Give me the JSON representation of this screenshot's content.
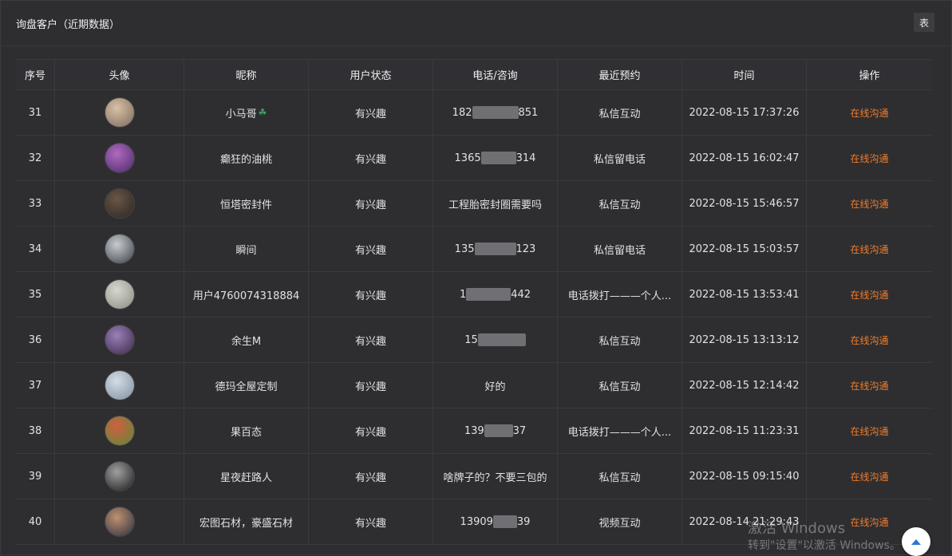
{
  "header": {
    "title": "询盘客户（近期数据）",
    "toggle_label": "表"
  },
  "table": {
    "columns": [
      "序号",
      "头像",
      "昵称",
      "用户状态",
      "电话/咨询",
      "最近预约",
      "时间",
      "操作"
    ],
    "rows": [
      {
        "index": "31",
        "nickname": "小马哥",
        "badge": "☘",
        "status": "有兴趣",
        "phone_prefix": "182",
        "phone_suffix": "851",
        "consult": "",
        "reservation": "私信互动",
        "time": "2022-08-15 17:37:26",
        "action": "在线沟通",
        "avatar_colors": [
          "#d9c0a6",
          "#7a6a5a"
        ]
      },
      {
        "index": "32",
        "nickname": "癫狂的油桃",
        "badge": "",
        "status": "有兴趣",
        "phone_prefix": "1365",
        "phone_suffix": "314",
        "consult": "",
        "reservation": "私信留电话",
        "time": "2022-08-15 16:02:47",
        "action": "在线沟通",
        "avatar_colors": [
          "#b06ac0",
          "#4a2a6a"
        ]
      },
      {
        "index": "33",
        "nickname": "恒塔密封件",
        "badge": "",
        "status": "有兴趣",
        "phone_prefix": "",
        "phone_suffix": "",
        "consult": "工程胎密封圈需要吗",
        "reservation": "私信互动",
        "time": "2022-08-15 15:46:57",
        "action": "在线沟通",
        "avatar_colors": [
          "#6a5646",
          "#2a2622"
        ]
      },
      {
        "index": "34",
        "nickname": "瞬间",
        "badge": "",
        "status": "有兴趣",
        "phone_prefix": "135",
        "phone_suffix": "123",
        "consult": "",
        "reservation": "私信留电话",
        "time": "2022-08-15 15:03:57",
        "action": "在线沟通",
        "avatar_colors": [
          "#c8ccd0",
          "#3a3e44"
        ]
      },
      {
        "index": "35",
        "nickname": "用户4760074318884",
        "badge": "",
        "status": "有兴趣",
        "phone_prefix": "1",
        "phone_suffix": "442",
        "consult": "",
        "reservation": "电话拨打———个人...",
        "time": "2022-08-15 13:53:41",
        "action": "在线沟通",
        "avatar_colors": [
          "#d6d8cf",
          "#8a8c80"
        ]
      },
      {
        "index": "36",
        "nickname": "余生M",
        "badge": "",
        "status": "有兴趣",
        "phone_prefix": "15",
        "phone_suffix": "",
        "consult": "",
        "reservation": "私信互动",
        "time": "2022-08-15 13:13:12",
        "action": "在线沟通",
        "avatar_colors": [
          "#9a80b8",
          "#3a2a4a"
        ]
      },
      {
        "index": "37",
        "nickname": "德玛全屋定制",
        "badge": "",
        "status": "有兴趣",
        "phone_prefix": "",
        "phone_suffix": "",
        "consult": "好的",
        "reservation": "私信互动",
        "time": "2022-08-15 12:14:42",
        "action": "在线沟通",
        "avatar_colors": [
          "#d4dce4",
          "#8090a0"
        ]
      },
      {
        "index": "38",
        "nickname": "果百态",
        "badge": "",
        "status": "有兴趣",
        "phone_prefix": "139",
        "phone_suffix": "37",
        "consult": "",
        "reservation": "电话拨打———个人...",
        "time": "2022-08-15 11:23:31",
        "action": "在线沟通",
        "avatar_colors": [
          "#d06040",
          "#5a8a3a"
        ]
      },
      {
        "index": "39",
        "nickname": "星夜赶路人",
        "badge": "",
        "status": "有兴趣",
        "phone_prefix": "",
        "phone_suffix": "",
        "consult": "啥牌子的？不要三包的",
        "reservation": "私信互动",
        "time": "2022-08-15 09:15:40",
        "action": "在线沟通",
        "avatar_colors": [
          "#a0a0a0",
          "#1a1a1a"
        ]
      },
      {
        "index": "40",
        "nickname": "宏图石材，豪盛石材",
        "badge": "",
        "status": "有兴趣",
        "phone_prefix": "13909",
        "phone_suffix": "39",
        "consult": "",
        "reservation": "视频互动",
        "time": "2022-08-14 21:29:43",
        "action": "在线沟通",
        "avatar_colors": [
          "#c09070",
          "#2a3040"
        ]
      }
    ]
  },
  "watermark": {
    "line1": "激活 Windows",
    "line2": "转到\"设置\"以激活 Windows。"
  },
  "colors": {
    "background": "#2e2e31",
    "action": "#f07d2a",
    "mask": "#6f6f74"
  },
  "icons": {
    "scroll_top": "chevron-up-icon"
  }
}
